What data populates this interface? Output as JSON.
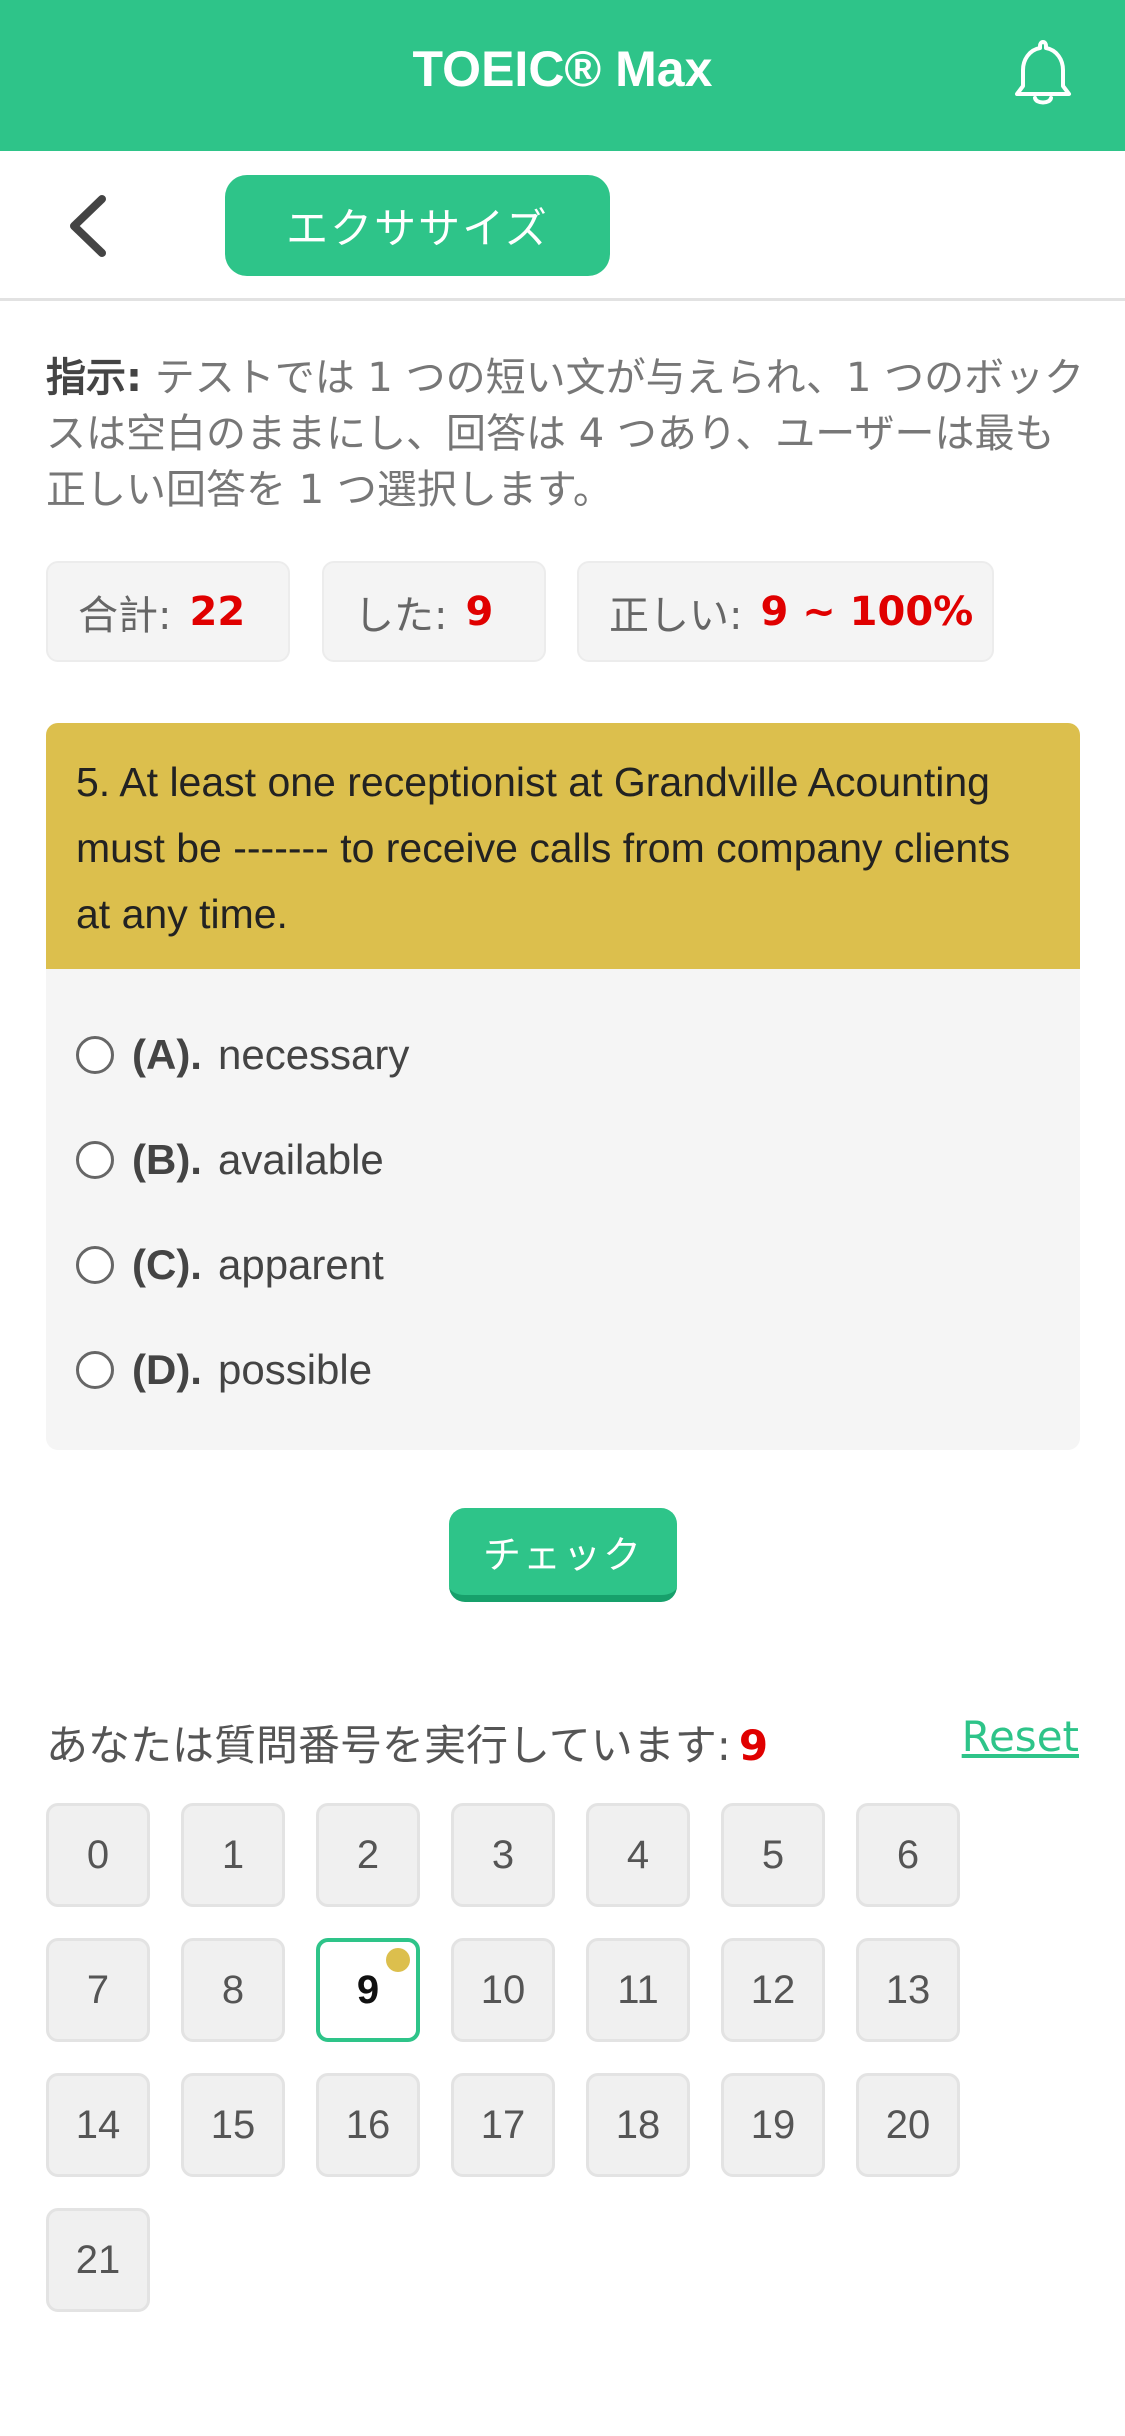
{
  "header": {
    "title": "TOEIC® Max",
    "bell_icon": "bell-icon"
  },
  "subbar": {
    "tab_label": "エクササイズ",
    "back_icon": "chevron-left-icon"
  },
  "instructions": {
    "label": "指示:",
    "text": " テストでは 1 つの短い文が与えられ、1 つのボックスは空白のままにし、回答は 4 つあり、ユーザーは最も正しい回答を 1 つ選択します。"
  },
  "stats": {
    "total_label": "合計:",
    "total_value": "22",
    "done_label": "した:",
    "done_value": "9",
    "correct_label": "正しい:",
    "correct_value": "9 ~ 100%"
  },
  "question": {
    "text": "5. At least one receptionist at Grandville Acounting must be ------- to receive calls from company clients at any time.",
    "options": [
      {
        "letter": "(A).",
        "text": "necessary"
      },
      {
        "letter": "(B).",
        "text": "available"
      },
      {
        "letter": "(C).",
        "text": "apparent"
      },
      {
        "letter": "(D).",
        "text": "possible"
      }
    ]
  },
  "check_label": "チェック",
  "progress": {
    "running_label": "あなたは質問番号を実行しています:",
    "running_value": "9",
    "reset_label": "Reset",
    "numbers": [
      "0",
      "1",
      "2",
      "3",
      "4",
      "5",
      "6",
      "7",
      "8",
      "9",
      "10",
      "11",
      "12",
      "13",
      "14",
      "15",
      "16",
      "17",
      "18",
      "19",
      "20",
      "21"
    ],
    "active": "9"
  },
  "colors": {
    "primary": "#2ec489",
    "question_bg": "#dcbf4d",
    "accent_red": "#e00000"
  }
}
